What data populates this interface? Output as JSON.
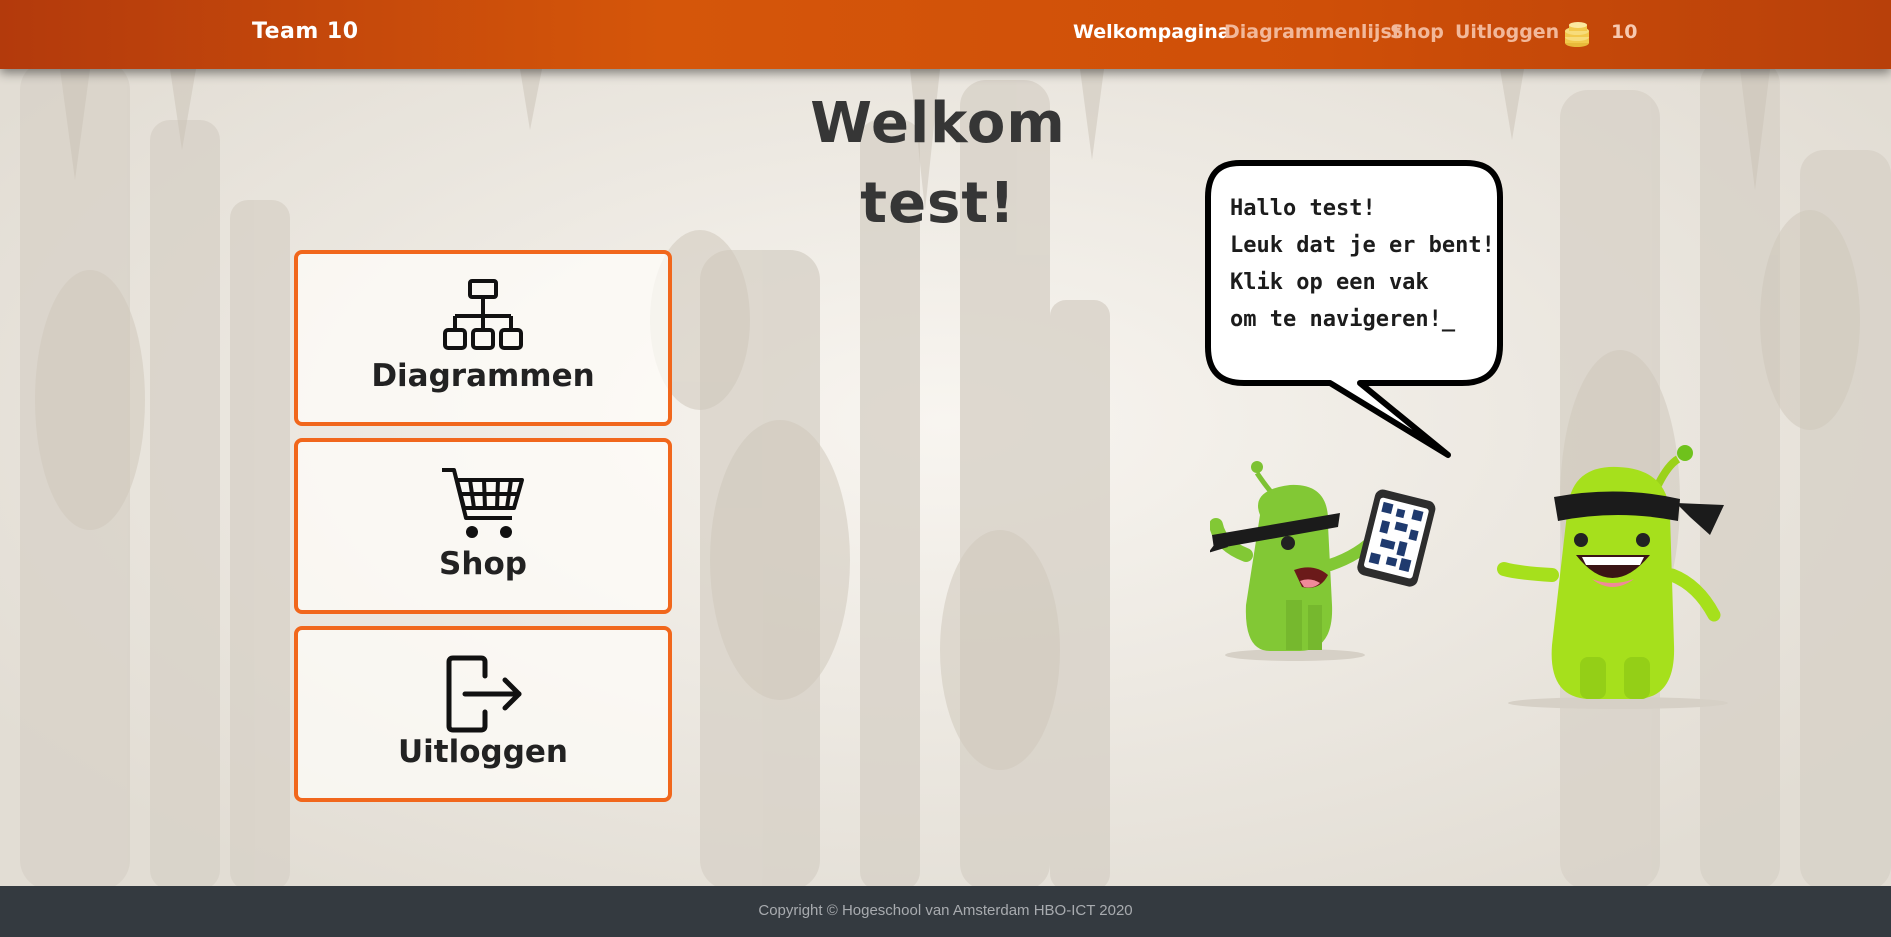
{
  "colors": {
    "navbar": "#cf4f08",
    "accent": "#f1671c",
    "footer": "#343a40",
    "monster_green": "#8dd41c"
  },
  "navbar": {
    "brand": "Team 10",
    "links": [
      {
        "label": "Welkompagina",
        "active": true
      },
      {
        "label": "Diagrammenlijst",
        "active": false
      },
      {
        "label": "Shop",
        "active": false
      },
      {
        "label": "Uitloggen",
        "active": false
      }
    ],
    "coins_icon": "coin-stack-icon",
    "coins": "10"
  },
  "welcome": {
    "line1": "Welkom",
    "line2": "test!"
  },
  "tiles": [
    {
      "label": "Diagrammen",
      "icon": "sitemap-icon"
    },
    {
      "label": "Shop",
      "icon": "shopping-cart-icon"
    },
    {
      "label": "Uitloggen",
      "icon": "logout-icon"
    }
  ],
  "speech": {
    "lines": [
      "Hallo test!",
      "Leuk dat je er bent!",
      "Klik op een vak",
      "om te navigeren!_"
    ]
  },
  "footer": {
    "copyright": "Copyright © Hogeschool van Amsterdam HBO-ICT 2020"
  }
}
